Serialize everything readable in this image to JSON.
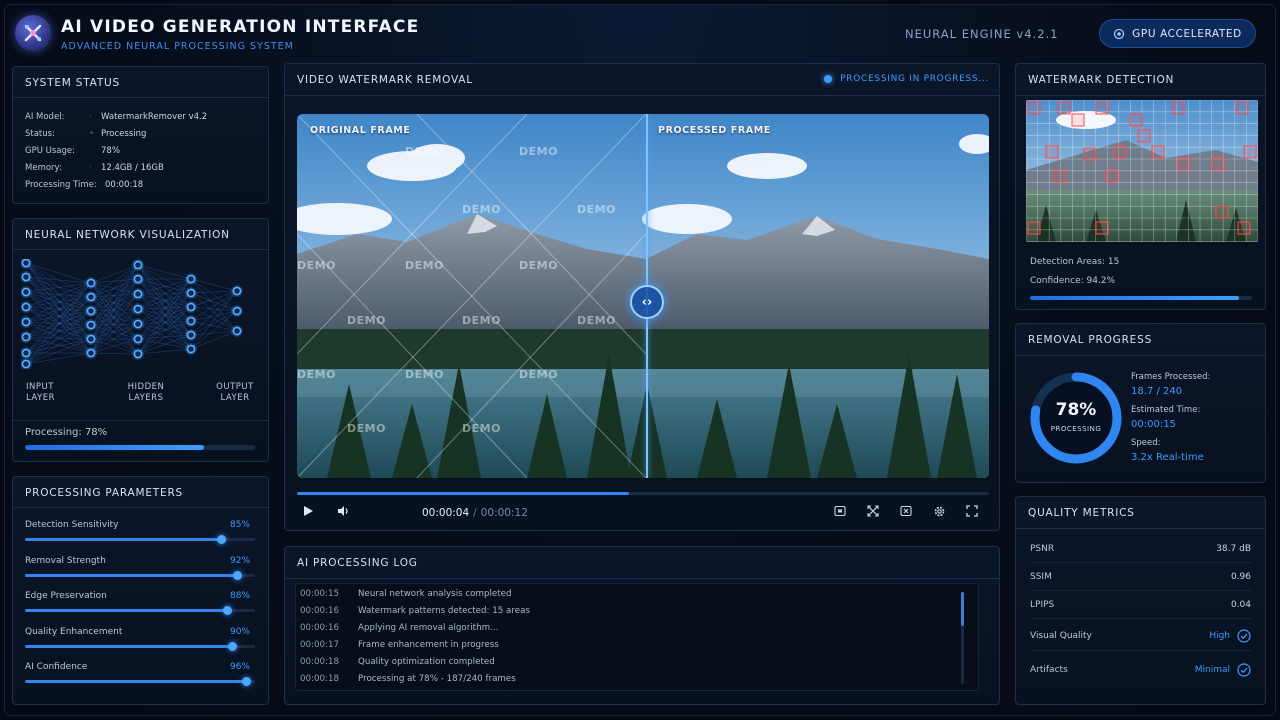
{
  "header": {
    "title": "AI VIDEO GENERATION INTERFACE",
    "subtitle": "ADVANCED NEURAL PROCESSING SYSTEM",
    "engine": "NEURAL ENGINE v4.2.1",
    "gpu_button": "GPU ACCELERATED"
  },
  "system_status": {
    "title": "SYSTEM STATUS",
    "rows": [
      {
        "key": "AI Model:",
        "value": "WatermarkRemover v4.2"
      },
      {
        "key": "Status:",
        "value": "Processing"
      },
      {
        "key": "GPU Usage:",
        "value": "78%"
      },
      {
        "key": "Memory:",
        "value": "12.4GB / 16GB"
      },
      {
        "key": "Processing Time:",
        "value": "00:00:18"
      }
    ]
  },
  "neural_network": {
    "title": "NEURAL NETWORK VISUALIZATION",
    "input_label": "INPUT\nLAYER",
    "hidden_label": "HIDDEN\nLAYERS",
    "output_label": "OUTPUT\nLAYER",
    "processing_label": "Processing: 78%",
    "processing_value": 0.78
  },
  "parameters": {
    "title": "PROCESSING PARAMETERS",
    "items": [
      {
        "name": "Detection Sensitivity",
        "value": "85%",
        "level": 0.85
      },
      {
        "name": "Removal Strength",
        "value": "92%",
        "level": 0.92
      },
      {
        "name": "Edge Preservation",
        "value": "88%",
        "level": 0.88
      },
      {
        "name": "Quality Enhancement",
        "value": "90%",
        "level": 0.9
      },
      {
        "name": "AI Confidence",
        "value": "96%",
        "level": 0.96
      }
    ]
  },
  "video": {
    "title": "VIDEO WATERMARK REMOVAL",
    "status": "PROCESSING IN PROGRESS...",
    "original_label": "ORIGINAL FRAME",
    "processed_label": "PROCESSED FRAME",
    "watermark_text": "DEMO",
    "current_time": "00:00:04",
    "separator": "/",
    "total_time": "00:00:12",
    "progress": 0.48
  },
  "log": {
    "title": "AI PROCESSING LOG",
    "entries": [
      {
        "time": "00:00:15",
        "message": "Neural network analysis completed"
      },
      {
        "time": "00:00:16",
        "message": "Watermark patterns detected: 15 areas"
      },
      {
        "time": "00:00:16",
        "message": "Applying AI removal algorithm..."
      },
      {
        "time": "00:00:17",
        "message": "Frame enhancement in progress"
      },
      {
        "time": "00:00:18",
        "message": "Quality optimization completed"
      },
      {
        "time": "00:00:18",
        "message": "Processing at 78% - 187/240 frames"
      }
    ]
  },
  "detection": {
    "title": "WATERMARK DETECTION",
    "areas_label": "Detection Areas: 15",
    "confidence_label": "Confidence: 94.2%",
    "confidence_value": 0.942
  },
  "removal_progress": {
    "title": "REMOVAL PROGRESS",
    "percent": "78%",
    "percent_value": 0.78,
    "ring_label": "PROCESSING",
    "frames_label": "Frames Processed:",
    "frames_value": "18.7 / 240",
    "time_label": "Estimated Time:",
    "time_value": "00:00:15",
    "speed_label": "Speed:",
    "speed_value": "3.2x Real-time"
  },
  "quality": {
    "title": "QUALITY METRICS",
    "rows": [
      {
        "name": "PSNR",
        "value": "38.7 dB"
      },
      {
        "name": "SSIM",
        "value": "0.96"
      },
      {
        "name": "LPIPS",
        "value": "0.04"
      },
      {
        "name": "Visual Quality",
        "value": "High"
      },
      {
        "name": "Artifacts",
        "value": "Minimal"
      }
    ]
  },
  "colors": {
    "accent": "#3f9bff",
    "background": "#050a14",
    "panel": "#0b1629"
  }
}
